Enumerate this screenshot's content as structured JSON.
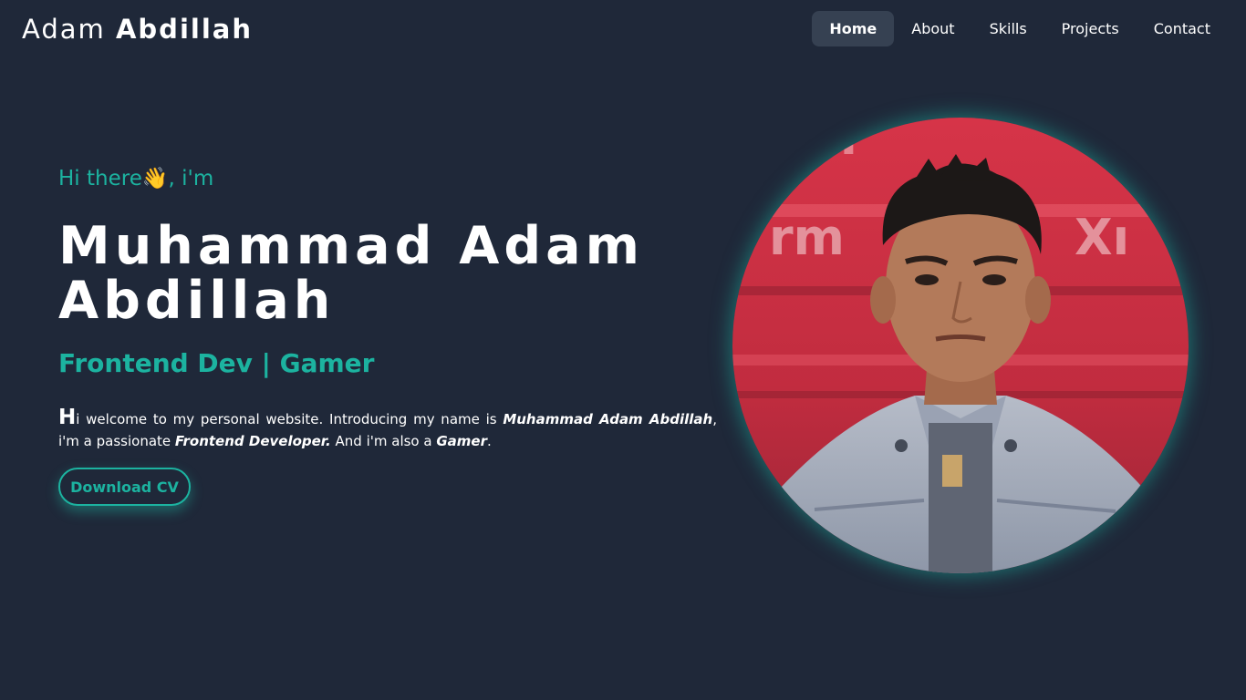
{
  "brand": {
    "first": "Adam",
    "last": "Abdillah"
  },
  "nav": {
    "items": [
      {
        "label": "Home"
      },
      {
        "label": "About"
      },
      {
        "label": "Skills"
      },
      {
        "label": "Projects"
      },
      {
        "label": "Contact"
      }
    ],
    "active": "Home"
  },
  "hero": {
    "greeting": "Hi there👋, i'm",
    "name": "Muhammad Adam Abdillah",
    "role": "Frontend Dev | Gamer",
    "intro": {
      "dropcap": "H",
      "part1": "i welcome to my personal website. Introducing my name is ",
      "name_emph": "Muhammad Adam Abdillah",
      "part2": ", i'm a passionate ",
      "role_emph": "Frontend Developer.",
      "part3": " And i'm also a ",
      "hobby_emph": "Gamer",
      "part4": "."
    },
    "cv_button": "Download CV",
    "photo_icon": "profile-photo"
  },
  "colors": {
    "background": "#1f2839",
    "accent": "#1cb3a0",
    "nav_active_bg": "#364152",
    "text": "#ffffff"
  }
}
